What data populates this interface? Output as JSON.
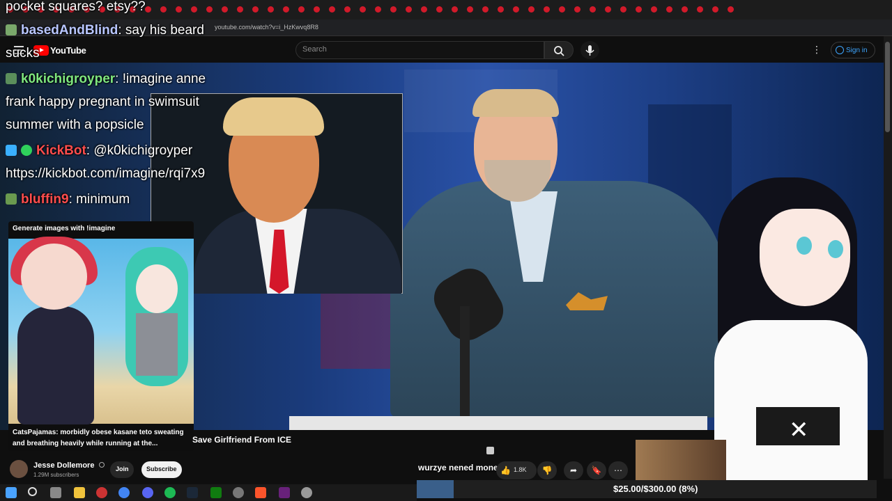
{
  "browser": {
    "url": "youtube.com/watch?v=i_HzKwvq8R8"
  },
  "youtube": {
    "logo_text": "YouTube",
    "search_placeholder": "Search",
    "signin_label": "Sign in",
    "more_icon": "vertical-dots-icon"
  },
  "chat": {
    "top_partial": "pocket squares? etsy??",
    "messages": [
      {
        "user": "basedAndBlind",
        "text": ": say his beard",
        "cont": "sucks",
        "name_color": "#b8c6ff"
      },
      {
        "user": "k0kichigroyper",
        "text": ": !imagine anne",
        "cont1": "frank happy pregnant in swimsuit",
        "cont2": "summer with a popsicle",
        "name_color": "#7fe77f"
      },
      {
        "user": "KickBot",
        "text": ": @k0kichigroyper",
        "cont": "https://kickbot.com/imagine/rqi7x9",
        "name_color": "#ff4d4d"
      },
      {
        "user": "bluffin9",
        "text": ": minimum",
        "name_color": "#ff4d4d"
      }
    ]
  },
  "imagine_card": {
    "title": "Generate images with !imagine",
    "caption": "CatsPajamas: morbidly obese kasane teto sweating and breathing heavily while running at the..."
  },
  "video": {
    "title_partial": "Save Girlfriend From ICE",
    "tts_text": "wurzye nened money",
    "like_count": "1.8K"
  },
  "channel": {
    "name": "Jesse Dollemore",
    "verified_icon": "verified-check-icon",
    "subscribers": "1.29M subscribers",
    "join_label": "Join",
    "subscribe_label": "Subscribe"
  },
  "goal": {
    "text": "$25.00/$300.00 (8%)",
    "progress_fraction": 0.08
  },
  "colors": {
    "accent_blue": "#3ea6ff",
    "youtube_red": "#ff0000",
    "tie_red": "#d4172a"
  }
}
